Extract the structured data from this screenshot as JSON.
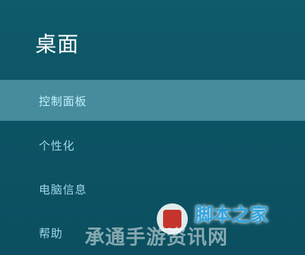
{
  "panel": {
    "title": "桌面"
  },
  "menu": {
    "items": [
      {
        "label": "控制面板",
        "selected": true
      },
      {
        "label": "个性化",
        "selected": false
      },
      {
        "label": "电脑信息",
        "selected": false
      },
      {
        "label": "帮助",
        "selected": false
      }
    ]
  },
  "watermark": {
    "site": "脚本之家",
    "sub": "承通手游资讯网"
  },
  "colors": {
    "background": "#0d5666",
    "selected": "#6fb3c2",
    "menu_text": "#9fd8e6",
    "title_text": "#ffffff"
  }
}
